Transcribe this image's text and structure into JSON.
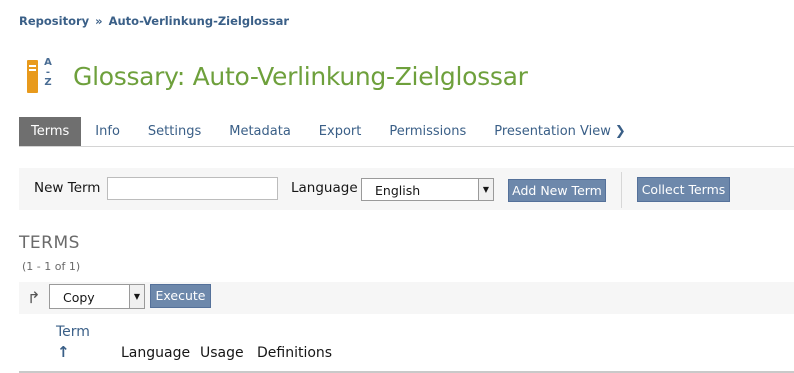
{
  "breadcrumb": {
    "items": [
      "Repository",
      "Auto-Verlinkung-Zielglossar"
    ],
    "separator": "»"
  },
  "header": {
    "title": "Glossary: Auto-Verlinkung-Zielglossar",
    "icon": "glossary-az-icon",
    "icon_letters": [
      "A",
      "-",
      "Z"
    ]
  },
  "tabs": [
    {
      "label": "Terms",
      "active": true
    },
    {
      "label": "Info"
    },
    {
      "label": "Settings"
    },
    {
      "label": "Metadata"
    },
    {
      "label": "Export"
    },
    {
      "label": "Permissions"
    },
    {
      "label": "Presentation View",
      "icon": "chevron-right-icon",
      "icon_glyph": "❯"
    }
  ],
  "form": {
    "new_term_label": "New Term",
    "new_term_value": "",
    "language_label": "Language",
    "language_value": "English",
    "add_button": "Add New Term",
    "collect_button": "Collect Terms"
  },
  "terms": {
    "heading": "TERMS",
    "count": "(1 - 1 of 1)",
    "action_select": "Copy",
    "execute_button": "Execute",
    "columns": {
      "term": "Term",
      "language": "Language",
      "usage": "Usage",
      "definitions": "Definitions"
    }
  },
  "colors": {
    "accent_title": "#6ea03c",
    "link": "#3a5f87",
    "button": "#6d88ab",
    "active_tab": "#6f6f6f",
    "icon_orange": "#e89a1c"
  }
}
